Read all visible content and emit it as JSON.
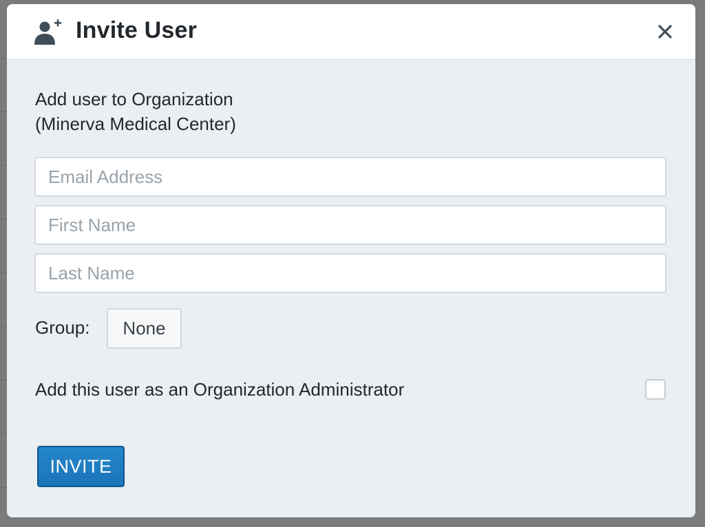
{
  "modal": {
    "title": "Invite User",
    "icon": "user-plus-icon",
    "close_icon": "close-icon"
  },
  "form": {
    "org_line_1": "Add user to Organization",
    "org_line_2": "(Minerva Medical Center)",
    "email": {
      "placeholder": "Email Address",
      "value": ""
    },
    "first_name": {
      "placeholder": "First Name",
      "value": ""
    },
    "last_name": {
      "placeholder": "Last Name",
      "value": ""
    },
    "group_label": "Group:",
    "group_value": "None",
    "admin_label": "Add this user as an Organization Administrator",
    "admin_checked": false,
    "invite_label": "INVITE"
  },
  "colors": {
    "primary": "#1a75b8",
    "modal_body_bg": "#eaeff3",
    "overlay": "#6e6f70"
  }
}
